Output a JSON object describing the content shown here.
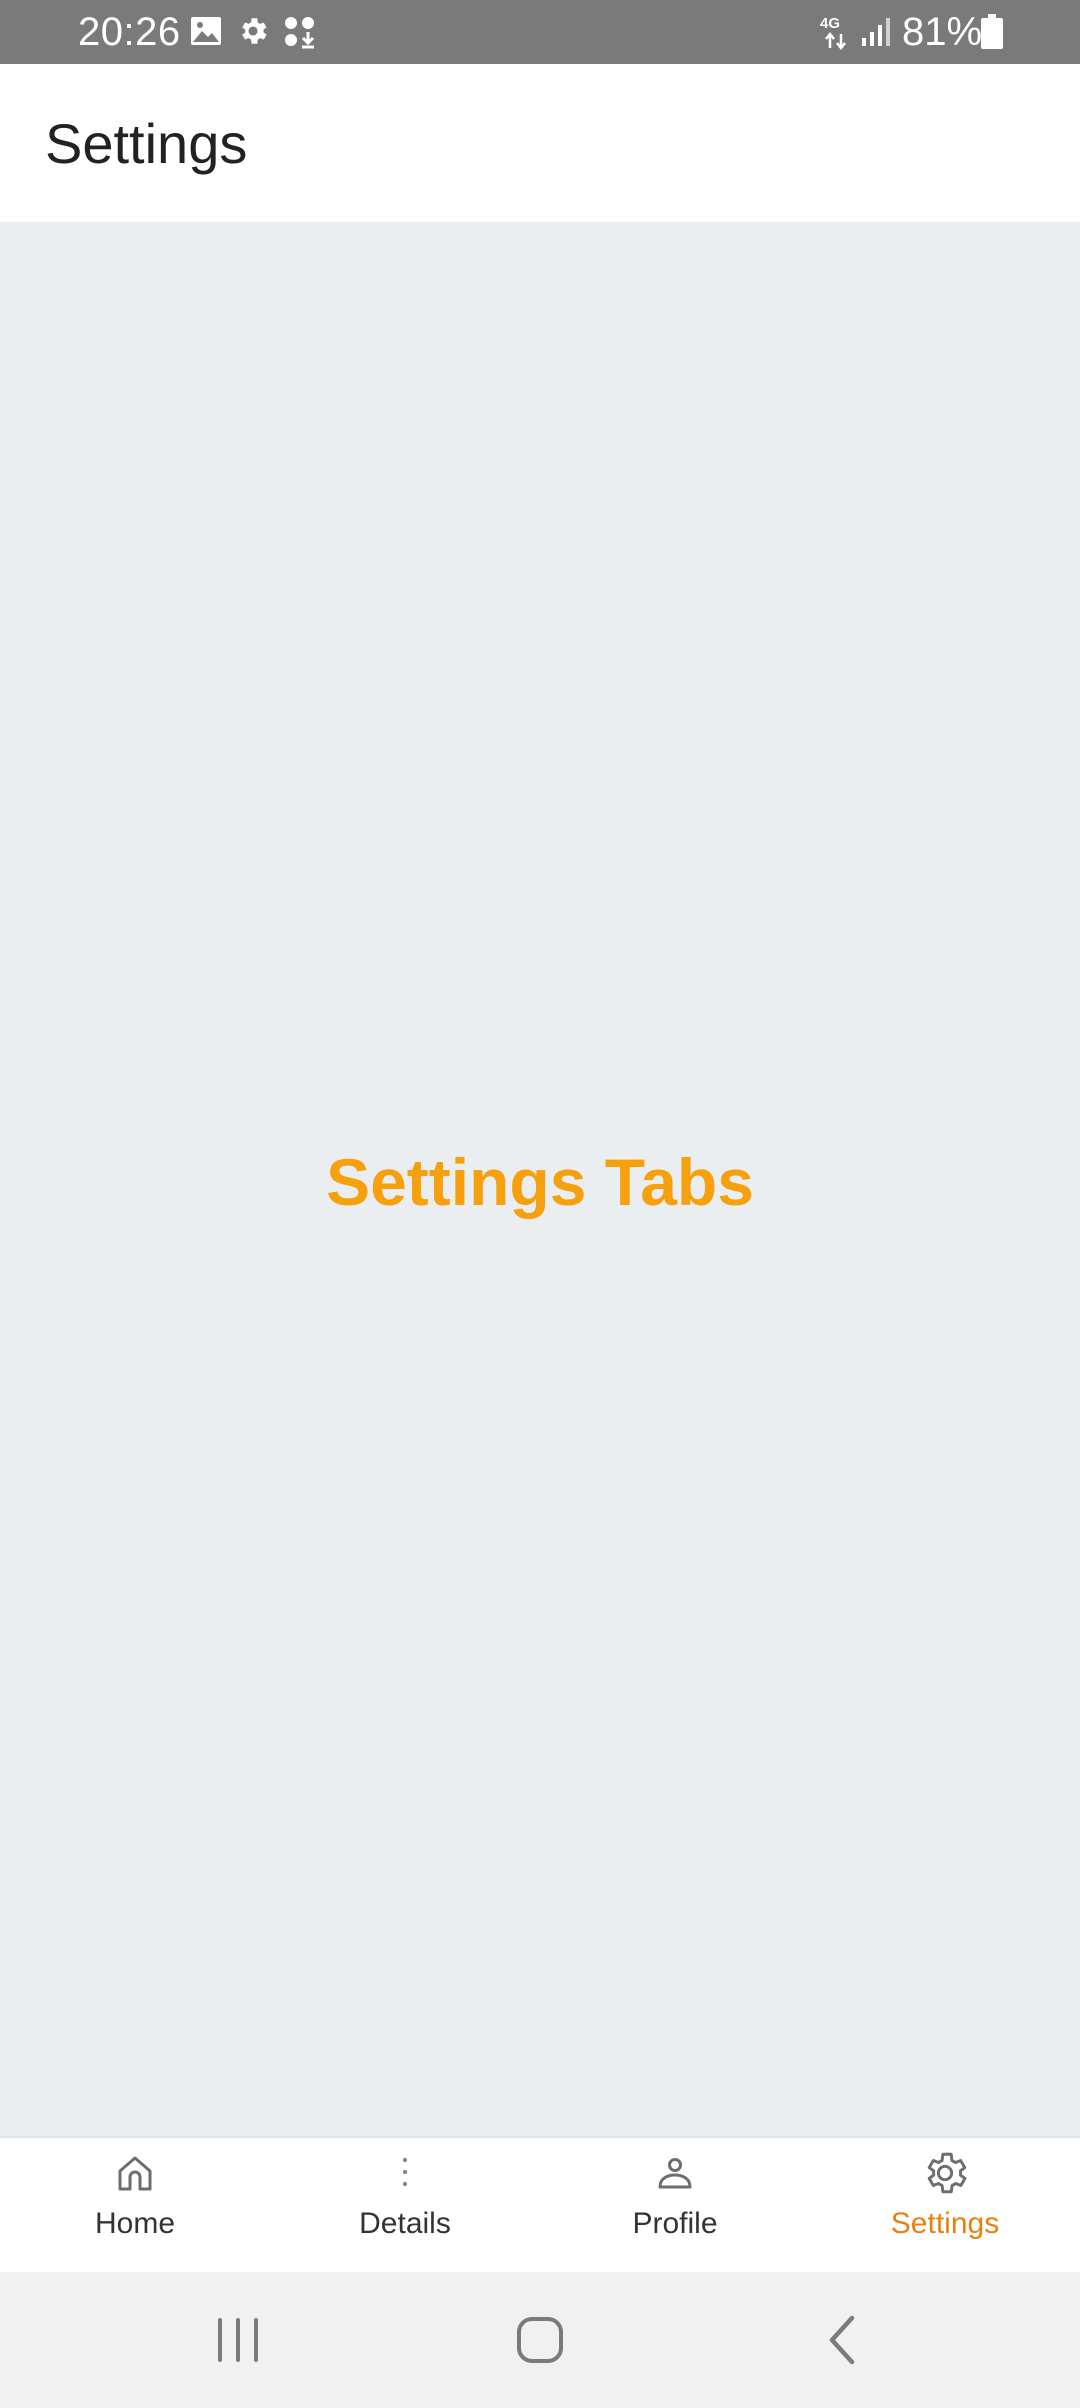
{
  "status_bar": {
    "time": "20:26",
    "network": "4G",
    "battery": "81%",
    "icons": [
      "image-icon",
      "gear-icon",
      "download-icon",
      "network-4g-icon",
      "signal-icon",
      "battery-icon"
    ]
  },
  "app_bar": {
    "title": "Settings"
  },
  "content": {
    "heading": "Settings Tabs",
    "heading_color": "#f5a00c"
  },
  "bottom_nav": {
    "active_color": "#e8810f",
    "items": [
      {
        "label": "Home",
        "icon": "home-icon"
      },
      {
        "label": "Details",
        "icon": "more-vertical-icon"
      },
      {
        "label": "Profile",
        "icon": "person-icon"
      },
      {
        "label": "Settings",
        "icon": "gear-icon",
        "active": true
      }
    ]
  },
  "system_nav": {
    "buttons": [
      "recents-icon",
      "home-icon",
      "back-icon"
    ]
  }
}
